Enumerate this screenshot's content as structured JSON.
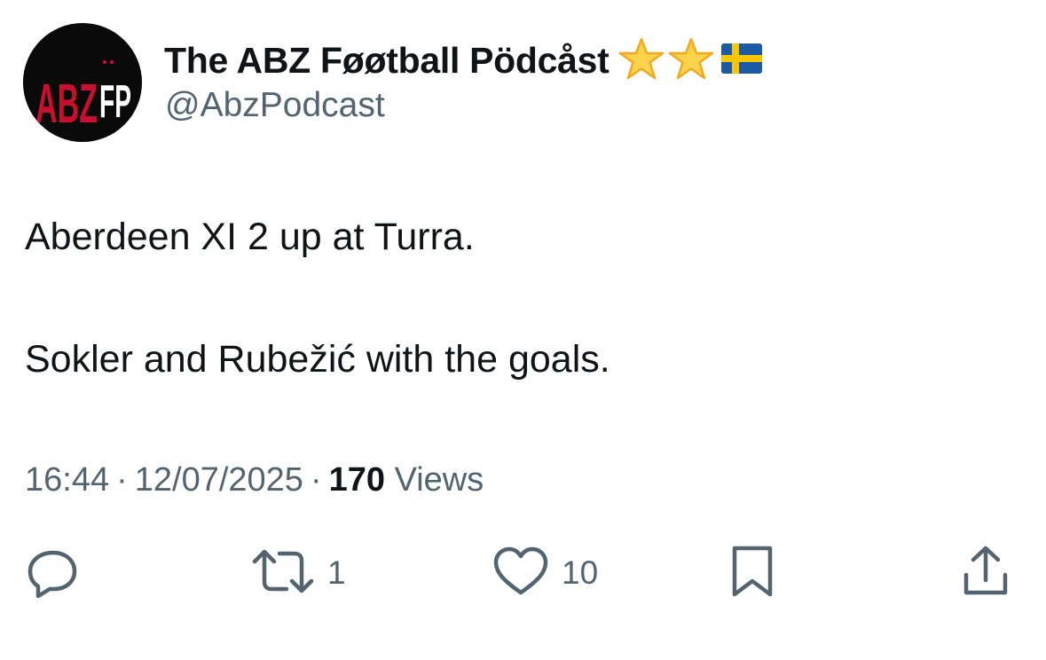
{
  "author": {
    "display_name": "The ABZ Føøtball Pödcåst",
    "handle": "@AbzPodcast",
    "avatar_text_left": "ABZ",
    "avatar_text_right": "FP",
    "badges": [
      "star-emoji",
      "star-emoji",
      "sweden-flag-emoji"
    ]
  },
  "tweet": {
    "line1": "Aberdeen XI 2 up at Turra.",
    "line2": "Sokler and Rubežić with the goals."
  },
  "meta": {
    "time": "16:44",
    "separator": "·",
    "date": "12/07/2025",
    "views_count": "170",
    "views_label": "Views"
  },
  "actions": {
    "reply_count": "",
    "repost_count": "1",
    "like_count": "10"
  },
  "colors": {
    "text_primary": "#0f1419",
    "text_secondary": "#536471",
    "avatar_red": "#c8102e",
    "star": "#f8c12c",
    "flag_blue": "#1c5aa6",
    "flag_yellow": "#f7c600"
  }
}
